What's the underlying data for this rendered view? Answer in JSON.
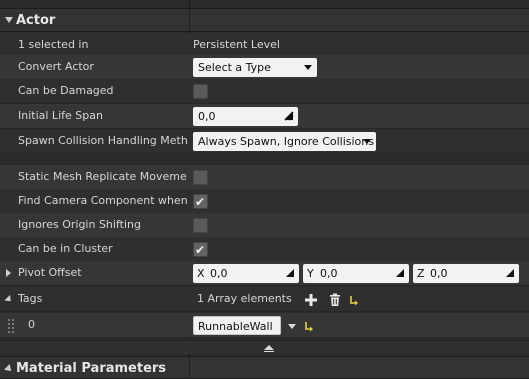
{
  "sections": {
    "actor": {
      "title": "Actor"
    },
    "material": {
      "title": "Material Parameters"
    }
  },
  "rows": {
    "selected": {
      "label": "1 selected in",
      "value": "Persistent Level"
    },
    "convert": {
      "label": "Convert Actor",
      "value": "Select a Type"
    },
    "damaged": {
      "label": "Can be Damaged",
      "checked": false
    },
    "lifespan": {
      "label": "Initial Life Span",
      "value": "0,0"
    },
    "spawn": {
      "label": "Spawn Collision Handling Method",
      "value": "Always Spawn, Ignore Collisions"
    },
    "staticmesh": {
      "label": "Static Mesh Replicate Movement",
      "checked": false
    },
    "camera": {
      "label": "Find Camera Component when Vie",
      "checked": true
    },
    "origin": {
      "label": "Ignores Origin Shifting",
      "checked": false
    },
    "cluster": {
      "label": "Can be in Cluster",
      "checked": true
    },
    "pivot": {
      "label": "Pivot Offset",
      "x_axis": "X",
      "x": "0,0",
      "y_axis": "Y",
      "y": "0,0",
      "z_axis": "Z",
      "z": "0,0"
    },
    "tags": {
      "label": "Tags",
      "count": "1 Array elements"
    },
    "tag0": {
      "index": "0",
      "value": "RunnableWall"
    }
  },
  "icons": {
    "add": "plus-icon",
    "delete": "trash-icon",
    "reset": "reset-arrow-icon"
  },
  "colors": {
    "panel": "#2f2f2f",
    "panel_alt": "#363636",
    "header": "#333333",
    "field": "#f2f2f2",
    "reset_yellow": "#e6d33a"
  }
}
